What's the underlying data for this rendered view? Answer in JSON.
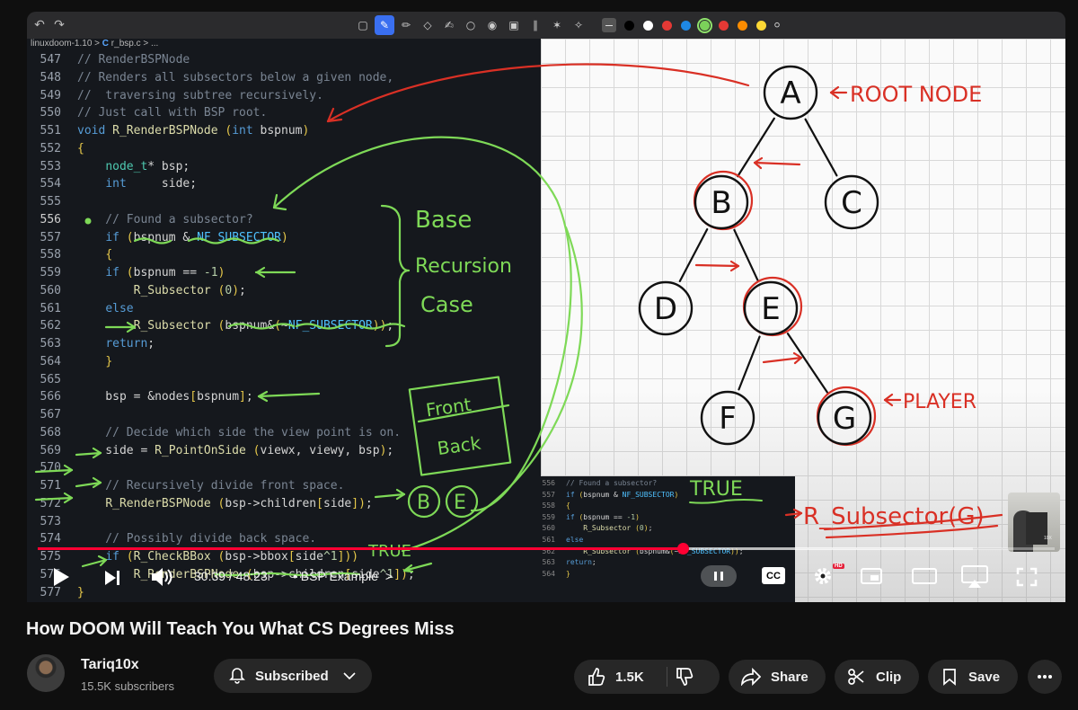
{
  "toolbar": {
    "undo_icon": "undo-icon",
    "redo_icon": "redo-icon",
    "tools": [
      "select-icon",
      "pen-icon",
      "pencil-icon",
      "eraser-icon",
      "highlighter-icon",
      "lasso-icon",
      "eye-icon",
      "crop-icon",
      "ruler-icon",
      "laser-icon",
      "picker-icon"
    ],
    "colors": [
      "#000000",
      "#ffffff",
      "#e53935",
      "#1e88e5",
      "#7bd15a",
      "#e53935",
      "#fb8c00",
      "#fdd835"
    ],
    "selected_color": "#7bd15a"
  },
  "editor": {
    "breadcrumb": {
      "folder": "linuxdoom-1.10",
      "sep": ">",
      "file_icon": "C",
      "file": "r_bsp.c",
      "more": "> ..."
    }
  },
  "code_lines": [
    {
      "n": "547",
      "t": "// RenderBSPNode"
    },
    {
      "n": "548",
      "t": "// Renders all subsectors below a given node,"
    },
    {
      "n": "549",
      "t": "//  traversing subtree recursively."
    },
    {
      "n": "550",
      "t": "// Just call with BSP root."
    },
    {
      "n": "551",
      "t": "void R_RenderBSPNode (int bspnum)"
    },
    {
      "n": "552",
      "t": "{"
    },
    {
      "n": "553",
      "t": "    node_t* bsp;"
    },
    {
      "n": "554",
      "t": "    int     side;"
    },
    {
      "n": "555",
      "t": ""
    },
    {
      "n": "556",
      "t": "    // Found a subsector?"
    },
    {
      "n": "557",
      "t": "    if (bspnum & NF_SUBSECTOR)"
    },
    {
      "n": "558",
      "t": "    {"
    },
    {
      "n": "559",
      "t": "    if (bspnum == -1)"
    },
    {
      "n": "560",
      "t": "        R_Subsector (0);"
    },
    {
      "n": "561",
      "t": "    else"
    },
    {
      "n": "562",
      "t": "        R_Subsector (bspnum&(~NF_SUBSECTOR));"
    },
    {
      "n": "563",
      "t": "    return;"
    },
    {
      "n": "564",
      "t": "    }"
    },
    {
      "n": "565",
      "t": ""
    },
    {
      "n": "566",
      "t": "    bsp = &nodes[bspnum];"
    },
    {
      "n": "567",
      "t": ""
    },
    {
      "n": "568",
      "t": "    // Decide which side the view point is on."
    },
    {
      "n": "569",
      "t": "    side = R_PointOnSide (viewx, viewy, bsp);"
    },
    {
      "n": "570",
      "t": ""
    },
    {
      "n": "571",
      "t": "    // Recursively divide front space."
    },
    {
      "n": "572",
      "t": "    R_RenderBSPNode (bsp->children[side]);"
    },
    {
      "n": "573",
      "t": ""
    },
    {
      "n": "574",
      "t": "    // Possibly divide back space."
    },
    {
      "n": "575",
      "t": "    if (R_CheckBBox (bsp->bbox[side^1]))"
    },
    {
      "n": "576",
      "t": "        R_RenderBSPNode (bsp->children[side^1]);"
    },
    {
      "n": "577",
      "t": "}"
    }
  ],
  "inset_lines": [
    {
      "n": "556",
      "t": "// Found a subsector?"
    },
    {
      "n": "557",
      "t": "if (bspnum & NF_SUBSECTOR)"
    },
    {
      "n": "558",
      "t": "{"
    },
    {
      "n": "559",
      "t": "if (bspnum == -1)"
    },
    {
      "n": "560",
      "t": "    R_Subsector (0);"
    },
    {
      "n": "561",
      "t": "else"
    },
    {
      "n": "562",
      "t": "    R_Subsector (bspnum&(~NF_SUBSECTOR));"
    },
    {
      "n": "563",
      "t": "return;"
    },
    {
      "n": "564",
      "t": "}"
    }
  ],
  "handwriting": {
    "base_case": [
      "Base",
      "Recursion",
      "Case"
    ],
    "front": "Front",
    "back": "Back",
    "b_e_b": "B",
    "b_e_e": "E",
    "true_bottom": "TRUE",
    "true_inset": "TRUE",
    "root_note": "ROOT NODE",
    "player_note": "PLAYER",
    "call_note": "R_Subsector(G)"
  },
  "tree": {
    "nodes": [
      {
        "id": "A",
        "label": "A",
        "highlighted": false
      },
      {
        "id": "B",
        "label": "B",
        "highlighted": true
      },
      {
        "id": "C",
        "label": "C",
        "highlighted": false
      },
      {
        "id": "D",
        "label": "D",
        "highlighted": false
      },
      {
        "id": "E",
        "label": "E",
        "highlighted": true
      },
      {
        "id": "F",
        "label": "F",
        "highlighted": false
      },
      {
        "id": "G",
        "label": "G",
        "highlighted": true
      }
    ],
    "edges": [
      [
        "A",
        "B"
      ],
      [
        "A",
        "C"
      ],
      [
        "B",
        "D"
      ],
      [
        "B",
        "E"
      ],
      [
        "E",
        "F"
      ],
      [
        "E",
        "G"
      ]
    ]
  },
  "webcam": {
    "label": "10X"
  },
  "player": {
    "current_time": "30:39",
    "separator": " / ",
    "duration": "48:23",
    "chapter": "• BSP Example",
    "chapter_chevron": ">",
    "progress": 0.634,
    "buffered": 0.92,
    "cc_label": "CC",
    "hd_badge": "HD",
    "icons": [
      "play-icon",
      "next-icon",
      "volume-icon",
      "pause-icon",
      "settings-icon",
      "miniplayer-icon",
      "theater-icon",
      "cast-icon",
      "fullscreen-icon"
    ]
  },
  "video": {
    "title": "How DOOM Will Teach You What CS Degrees Miss",
    "channel": "Tariq10x",
    "subscribers": "15.5K subscribers",
    "subscribed_label": "Subscribed",
    "like_count": "1.5K",
    "share_label": "Share",
    "clip_label": "Clip",
    "save_label": "Save"
  }
}
